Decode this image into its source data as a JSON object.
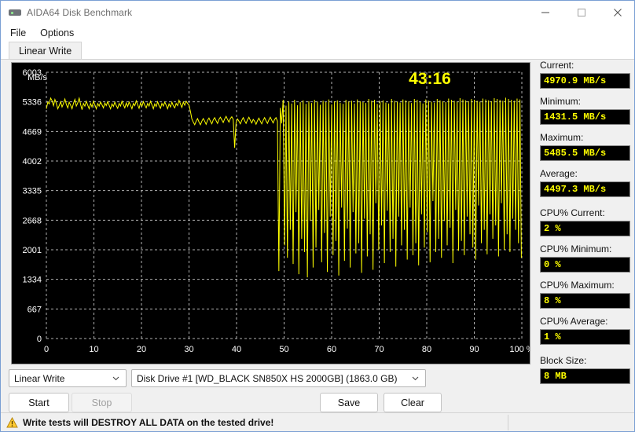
{
  "window": {
    "title": "AIDA64 Disk Benchmark",
    "icon": "disk-drive-icon",
    "buttons": {
      "minimize": "minimize-icon",
      "maximize": "maximize-icon",
      "close": "close-icon"
    }
  },
  "menu": {
    "items": [
      {
        "label": "File"
      },
      {
        "label": "Options"
      }
    ]
  },
  "tabs": [
    {
      "label": "Linear Write",
      "active": true
    }
  ],
  "stats": [
    {
      "key": "current",
      "label": "Current:",
      "value": "4970.9 MB/s",
      "gap": false
    },
    {
      "key": "minimum",
      "label": "Minimum:",
      "value": "1431.5 MB/s",
      "gap": false
    },
    {
      "key": "maximum",
      "label": "Maximum:",
      "value": "5485.5 MB/s",
      "gap": false
    },
    {
      "key": "average",
      "label": "Average:",
      "value": "4497.3 MB/s",
      "gap": false
    },
    {
      "key": "cpu_current",
      "label": "CPU% Current:",
      "value": "2 %",
      "gap": true
    },
    {
      "key": "cpu_minimum",
      "label": "CPU% Minimum:",
      "value": "0 %",
      "gap": false
    },
    {
      "key": "cpu_maximum",
      "label": "CPU% Maximum:",
      "value": "8 %",
      "gap": false
    },
    {
      "key": "cpu_average",
      "label": "CPU% Average:",
      "value": "1 %",
      "gap": false
    },
    {
      "key": "block_size",
      "label": "Block Size:",
      "value": "8 MB",
      "gap": true
    }
  ],
  "controls": {
    "mode_combo": {
      "value": "Linear Write",
      "arrow": "chevron-down-icon"
    },
    "drive_combo": {
      "value": "Disk Drive #1  [WD_BLACK SN850X HS 2000GB]  (1863.0 GB)",
      "arrow": "chevron-down-icon"
    },
    "start_button": "Start",
    "stop_button": "Stop",
    "stop_disabled": true,
    "save_button": "Save",
    "clear_button": "Clear"
  },
  "statusbar": {
    "warning_icon": "warning-triangle-icon",
    "warning_text": "Write tests will DESTROY ALL DATA on the tested drive!"
  },
  "colors": {
    "trace": "#ffff00",
    "chart_bg": "#000000",
    "grid": "#b0b0b0",
    "axis_text": "#ffffff",
    "value_text": "#ffff00",
    "window_bg": "#f0f0f0"
  },
  "chart_data": {
    "type": "line",
    "title": "",
    "timer": "43:16",
    "xlabel": "",
    "ylabel": "MB/s",
    "unit_label": "MB/s",
    "x_suffix": "%",
    "xlim": [
      0,
      100
    ],
    "ylim": [
      0,
      6003
    ],
    "grid": true,
    "legend": "none",
    "xticks": [
      0,
      10,
      20,
      30,
      40,
      50,
      60,
      70,
      80,
      90,
      100
    ],
    "xtick_labels": [
      "0",
      "10",
      "20",
      "30",
      "40",
      "50",
      "60",
      "70",
      "80",
      "90",
      "100 %"
    ],
    "yticks": [
      0,
      667,
      1334,
      2001,
      2668,
      3335,
      4002,
      4669,
      5336,
      6003
    ],
    "ytick_labels": [
      "0",
      "667",
      "1334",
      "2001",
      "2668",
      "3335",
      "4002",
      "4669",
      "5336",
      "6003"
    ],
    "series": [
      {
        "name": "Linear Write",
        "color": "#ffff00",
        "x": [
          0.0,
          0.3,
          0.6,
          0.9,
          1.2,
          1.5,
          1.8,
          2.1,
          2.4,
          2.7,
          3.0,
          3.3,
          3.6,
          3.9,
          4.2,
          4.5,
          4.8,
          5.1,
          5.4,
          5.7,
          6.0,
          6.3,
          6.6,
          6.9,
          7.2,
          7.5,
          7.8,
          8.1,
          8.4,
          8.7,
          9.0,
          9.3,
          9.6,
          9.9,
          10.2,
          10.5,
          10.8,
          11.1,
          11.4,
          11.7,
          12.0,
          12.3,
          12.6,
          12.9,
          13.2,
          13.5,
          13.8,
          14.1,
          14.4,
          14.7,
          15.0,
          15.3,
          15.6,
          15.9,
          16.2,
          16.5,
          16.8,
          17.1,
          17.4,
          17.7,
          18.0,
          18.3,
          18.6,
          18.9,
          19.2,
          19.5,
          19.8,
          20.1,
          20.4,
          20.7,
          21.0,
          21.3,
          21.6,
          21.9,
          22.2,
          22.5,
          22.8,
          23.1,
          23.4,
          23.7,
          24.0,
          24.3,
          24.6,
          24.9,
          25.2,
          25.5,
          25.8,
          26.1,
          26.4,
          26.7,
          27.0,
          27.3,
          27.6,
          27.9,
          28.2,
          28.5,
          28.8,
          29.1,
          29.4,
          29.7,
          30.0,
          30.3,
          30.6,
          30.9,
          31.2,
          31.5,
          31.8,
          32.1,
          32.4,
          32.7,
          33.0,
          33.3,
          33.6,
          33.9,
          34.2,
          34.5,
          34.8,
          35.1,
          35.4,
          35.7,
          36.0,
          36.3,
          36.6,
          36.9,
          37.2,
          37.5,
          37.8,
          38.1,
          38.4,
          38.7,
          39.0,
          39.3,
          39.6,
          39.9,
          40.2,
          40.5,
          40.8,
          41.1,
          41.4,
          41.7,
          42.0,
          42.3,
          42.6,
          42.9,
          43.2,
          43.5,
          43.8,
          44.1,
          44.4,
          44.7,
          45.0,
          45.3,
          45.6,
          45.9,
          46.2,
          46.5,
          46.8,
          47.1,
          47.4,
          47.7,
          48.0,
          48.3,
          48.6,
          48.9,
          49.2,
          49.5,
          49.8,
          50.1,
          50.4,
          50.7,
          51.0,
          51.3,
          51.6,
          51.9,
          52.2,
          52.5,
          52.8,
          53.1,
          53.4,
          53.7,
          54.0,
          54.3,
          54.6,
          54.9,
          55.2,
          55.5,
          55.8,
          56.1,
          56.4,
          56.7,
          57.0,
          57.3,
          57.6,
          57.9,
          58.2,
          58.5,
          58.8,
          59.1,
          59.4,
          59.7,
          60.0,
          60.3,
          60.6,
          60.9,
          61.2,
          61.5,
          61.8,
          62.1,
          62.4,
          62.7,
          63.0,
          63.3,
          63.6,
          63.9,
          64.2,
          64.5,
          64.8,
          65.1,
          65.4,
          65.7,
          66.0,
          66.3,
          66.6,
          66.9,
          67.2,
          67.5,
          67.8,
          68.1,
          68.4,
          68.7,
          69.0,
          69.3,
          69.6,
          69.9,
          70.2,
          70.5,
          70.8,
          71.1,
          71.4,
          71.7,
          72.0,
          72.3,
          72.6,
          72.9,
          73.2,
          73.5,
          73.8,
          74.1,
          74.4,
          74.7,
          75.0,
          75.3,
          75.6,
          75.9,
          76.2,
          76.5,
          76.8,
          77.1,
          77.4,
          77.7,
          78.0,
          78.3,
          78.6,
          78.9,
          79.2,
          79.5,
          79.8,
          80.1,
          80.4,
          80.7,
          81.0,
          81.3,
          81.6,
          81.9,
          82.2,
          82.5,
          82.8,
          83.1,
          83.4,
          83.7,
          84.0,
          84.3,
          84.6,
          84.9,
          85.2,
          85.5,
          85.8,
          86.1,
          86.4,
          86.7,
          87.0,
          87.3,
          87.6,
          87.9,
          88.2,
          88.5,
          88.8,
          89.1,
          89.4,
          89.7,
          90.0,
          90.3,
          90.6,
          90.9,
          91.2,
          91.5,
          91.8,
          92.1,
          92.4,
          92.7,
          93.0,
          93.3,
          93.6,
          93.9,
          94.2,
          94.5,
          94.8,
          95.1,
          95.4,
          95.7,
          96.0,
          96.3,
          96.6,
          96.9,
          97.2,
          97.5,
          97.8,
          98.1,
          98.4,
          98.7,
          99.0,
          99.3,
          99.6,
          99.9
        ],
        "y": [
          5180,
          5330,
          5290,
          5420,
          5360,
          5250,
          5390,
          5300,
          5180,
          5250,
          5340,
          5220,
          5300,
          5400,
          5280,
          5200,
          5330,
          5260,
          5180,
          5300,
          5390,
          5240,
          5310,
          5420,
          5280,
          5160,
          5300,
          5240,
          5350,
          5260,
          5180,
          5300,
          5220,
          5350,
          5270,
          5180,
          5300,
          5240,
          5330,
          5270,
          5200,
          5310,
          5250,
          5340,
          5260,
          5180,
          5290,
          5230,
          5330,
          5250,
          5190,
          5300,
          5240,
          5350,
          5270,
          5200,
          5310,
          5230,
          5330,
          5260,
          5180,
          5300,
          5250,
          5360,
          5270,
          5190,
          5310,
          5240,
          5340,
          5260,
          5200,
          5300,
          5240,
          5350,
          5270,
          5180,
          5290,
          5230,
          5340,
          5250,
          5190,
          5300,
          5240,
          5330,
          5260,
          5180,
          5290,
          5220,
          5330,
          5250,
          5200,
          5300,
          5250,
          5370,
          5290,
          5210,
          5330,
          5260,
          5350,
          5300,
          5260,
          5120,
          4950,
          4880,
          4820,
          4900,
          4960,
          4880,
          4820,
          4900,
          4960,
          4900,
          4830,
          4920,
          4970,
          4900,
          4840,
          4930,
          4980,
          4910,
          4850,
          4940,
          4990,
          4930,
          4870,
          4950,
          5010,
          4940,
          4880,
          4960,
          5000,
          4940,
          4300,
          4870,
          4950,
          4900,
          4840,
          4920,
          4980,
          4910,
          4850,
          4930,
          4990,
          4920,
          4860,
          4940,
          4900,
          4830,
          4910,
          4970,
          4900,
          4840,
          4920,
          4980,
          4910,
          4850,
          4930,
          4990,
          4920,
          4860,
          4940,
          4980,
          4900,
          1520,
          5200,
          4850,
          5380,
          2100,
          5250,
          1820,
          5340,
          2450,
          5300,
          1680,
          5380,
          2850,
          5260,
          1450,
          5330,
          2250,
          5370,
          1950,
          5290,
          1380,
          5350,
          2650,
          5310,
          1600,
          5380,
          2050,
          5340,
          2900,
          5270,
          1720,
          5360,
          2380,
          5330,
          1500,
          5390,
          2750,
          5280,
          1880,
          5350,
          2200,
          5370,
          1420,
          5310,
          2950,
          5290,
          1750,
          5380,
          2480,
          5340,
          1600,
          5360,
          2850,
          5300,
          1920,
          5390,
          2150,
          5350,
          1480,
          5330,
          2700,
          5310,
          1850,
          5400,
          2350,
          5360,
          1550,
          5380,
          3050,
          5290,
          2000,
          5350,
          2550,
          5370,
          1700,
          5320,
          2880,
          5300,
          1950,
          5400,
          2250,
          5360,
          1620,
          5340,
          2750,
          5320,
          2100,
          5390,
          2450,
          5370,
          1780,
          5350,
          2950,
          5310,
          1880,
          5400,
          2150,
          5380,
          1650,
          5330,
          2800,
          5300,
          2050,
          5390,
          2400,
          5360,
          1720,
          5340,
          3100,
          5320,
          1950,
          5400,
          2250,
          5370,
          1820,
          5350,
          2650,
          5330,
          2100,
          5410,
          2500,
          5380,
          1700,
          5360,
          2900,
          5340,
          1980,
          5420,
          2200,
          5390,
          1880,
          5370,
          2750,
          5350,
          2350,
          5400,
          2050,
          5380,
          1780,
          5360,
          3000,
          5340,
          2150,
          5410,
          2450,
          5390,
          1900,
          5370,
          2800,
          5350,
          2250,
          5420,
          2550,
          5400,
          1850,
          5380,
          3050,
          5360,
          2000,
          5430,
          2350,
          5400,
          1950,
          5380,
          2700,
          5360,
          2450,
          5410,
          2150,
          5390,
          1820,
          5370,
          2950,
          5350,
          2250,
          5420,
          2500,
          5400,
          1980,
          5380,
          2850,
          5360,
          2400,
          5430,
          2100,
          5410,
          4200,
          4800,
          4350,
          5100,
          4100,
          5200,
          3900,
          5150,
          2650,
          5300,
          2250,
          5250,
          2050,
          5280,
          2550,
          5320,
          2350,
          5300,
          2150,
          5340,
          2850,
          5310,
          2450,
          5360,
          2250,
          5330,
          3050,
          5370,
          2650,
          5340,
          2400,
          5390,
          2850,
          5360,
          3000,
          5400,
          2750,
          5380,
          2550,
          5410,
          3100,
          5390,
          2900,
          5430,
          2650,
          5410
        ]
      }
    ]
  }
}
